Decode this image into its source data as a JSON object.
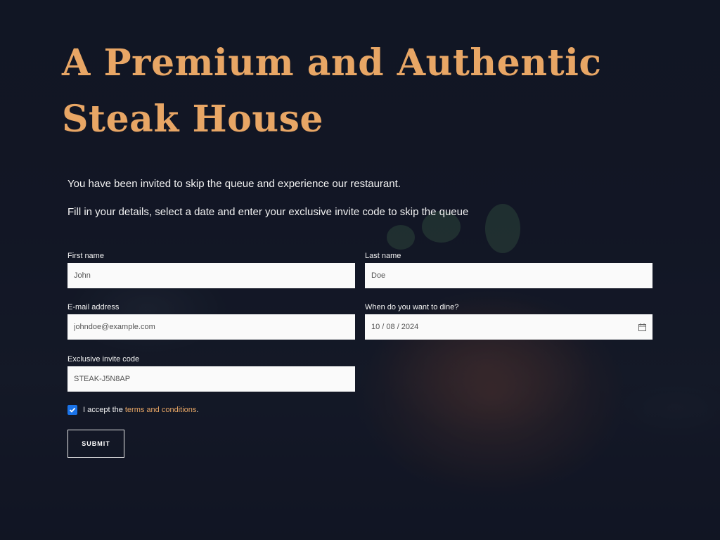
{
  "hero": {
    "title_line1": "A Premium and Authentic",
    "title_line2": "Steak House"
  },
  "intro": {
    "line1": "You have been invited to skip the queue and experience our restaurant.",
    "line2": "Fill in your details, select a date and enter your exclusive invite code to skip the queue"
  },
  "form": {
    "first_name": {
      "label": "First name",
      "value": "John"
    },
    "last_name": {
      "label": "Last name",
      "value": "Doe"
    },
    "email": {
      "label": "E-mail address",
      "value": "johndoe@example.com"
    },
    "dine_date": {
      "label": "When do you want to dine?",
      "value": "10 / 08 / 2024",
      "icon": "calendar-icon"
    },
    "invite_code": {
      "label": "Exclusive invite code",
      "value": "STEAK-J5N8AP"
    },
    "terms": {
      "checked": true,
      "prefix": "I accept the",
      "link": "terms and conditions",
      "suffix": "."
    },
    "submit_label": "SUBMIT"
  },
  "colors": {
    "accent": "#e8a665",
    "background": "#131826",
    "field_bg": "#fafafa",
    "checkbox": "#1a73e8"
  }
}
